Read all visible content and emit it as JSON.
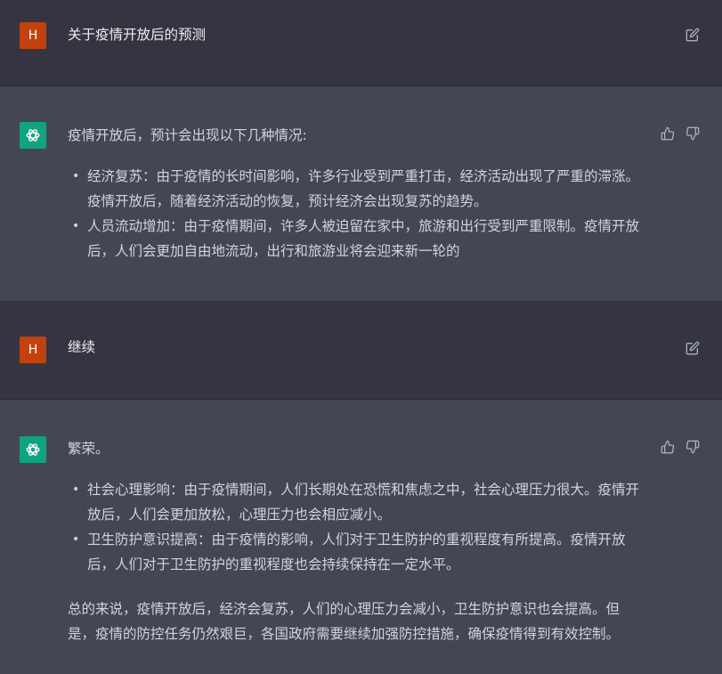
{
  "messages": [
    {
      "role": "user",
      "avatar_letter": "H",
      "text": "关于疫情开放后的预测"
    },
    {
      "role": "assistant",
      "intro": "疫情开放后，预计会出现以下几种情况:",
      "bullets": [
        "经济复苏：由于疫情的长时间影响，许多行业受到严重打击，经济活动出现了严重的滞涨。疫情开放后，随着经济活动的恢复，预计经济会出现复苏的趋势。",
        "人员流动增加：由于疫情期间，许多人被迫留在家中，旅游和出行受到严重限制。疫情开放后，人们会更加自由地流动，出行和旅游业将会迎来新一轮的"
      ]
    },
    {
      "role": "user",
      "avatar_letter": "H",
      "text": "继续"
    },
    {
      "role": "assistant",
      "intro": "繁荣。",
      "bullets": [
        "社会心理影响：由于疫情期间，人们长期处在恐慌和焦虑之中，社会心理压力很大。疫情开放后，人们会更加放松，心理压力也会相应减小。",
        "卫生防护意识提高：由于疫情的影响，人们对于卫生防护的重视程度有所提高。疫情开放后，人们对于卫生防护的重视程度也会持续保持在一定水平。"
      ],
      "conclusion": "总的来说，疫情开放后，经济会复苏，人们的心理压力会减小，卫生防护意识也会提高。但是，疫情的防控任务仍然艰巨，各国政府需要继续加强防控措施，确保疫情得到有效控制。"
    }
  ],
  "icons": {
    "edit": "edit-icon",
    "thumbs_up": "thumbs-up-icon",
    "thumbs_down": "thumbs-down-icon",
    "assistant_logo": "openai-logo-icon"
  },
  "colors": {
    "user_bg": "#343541",
    "assistant_bg": "#444654",
    "user_avatar": "#c2410c",
    "assistant_avatar": "#10a37f"
  }
}
